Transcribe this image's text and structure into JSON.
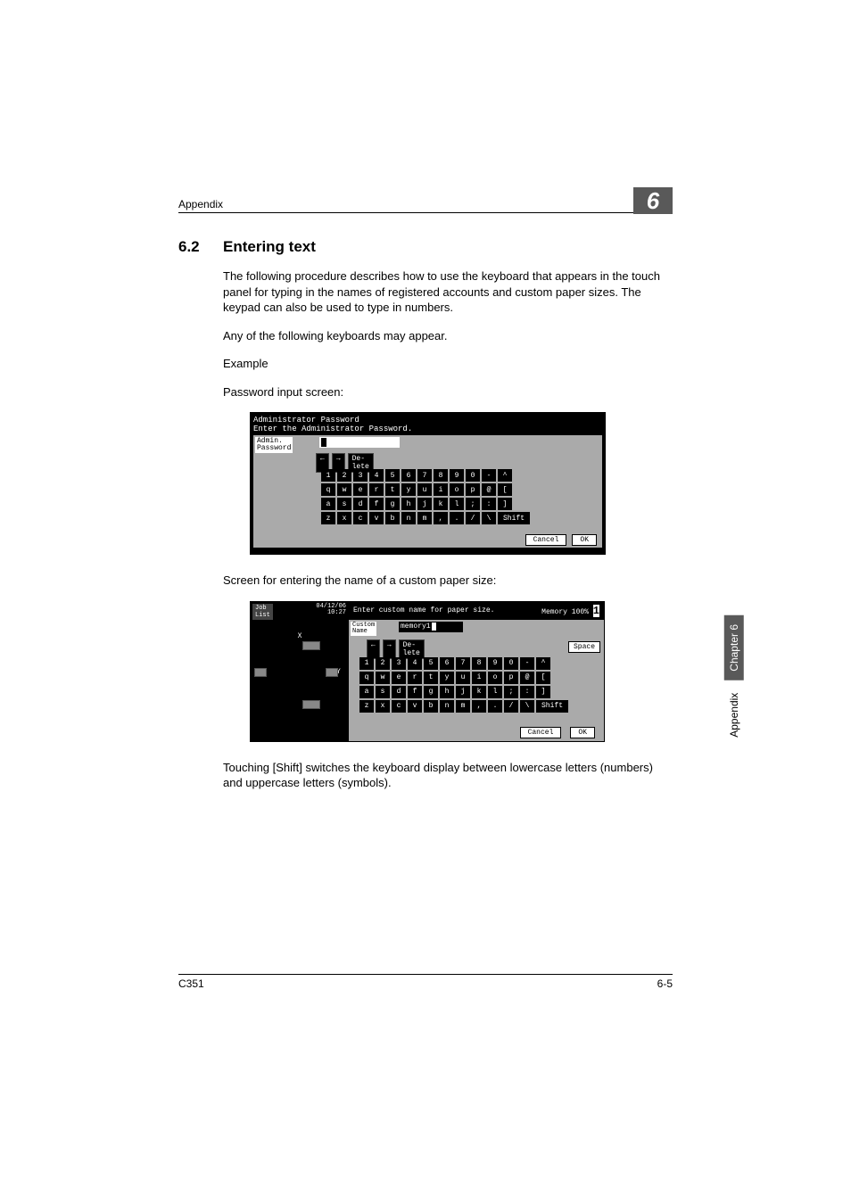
{
  "header": {
    "appendix": "Appendix",
    "chapter_number": "6"
  },
  "section": {
    "number": "6.2",
    "title": "Entering text"
  },
  "paragraphs": {
    "intro": "The following procedure describes how to use the keyboard that appears in the touch panel for typing in the names of registered accounts and custom paper sizes. The keypad can also be used to type in numbers.",
    "any_kb": "Any of the following keyboards may appear.",
    "example": "Example",
    "pwd_screen": "Password input screen:",
    "custom_screen": "Screen for entering the name of a custom paper size:",
    "shift_note": "Touching [Shift] switches the keyboard display between lowercase letters (numbers) and uppercase letters (symbols)."
  },
  "screenshot1": {
    "title_line1": "Administrator Password",
    "title_line2": "Enter the Administrator Password.",
    "label_l1": "Admin.",
    "label_l2": "Password",
    "nav_left": "←",
    "nav_right": "→",
    "nav_delete": "De-\nlete",
    "rows": {
      "r1": [
        "1",
        "2",
        "3",
        "4",
        "5",
        "6",
        "7",
        "8",
        "9",
        "0",
        "-",
        "^"
      ],
      "r2": [
        "q",
        "w",
        "e",
        "r",
        "t",
        "y",
        "u",
        "i",
        "o",
        "p",
        "@",
        "["
      ],
      "r3": [
        "a",
        "s",
        "d",
        "f",
        "g",
        "h",
        "j",
        "k",
        "l",
        ";",
        ":",
        "]"
      ],
      "r4": [
        "z",
        "x",
        "c",
        "v",
        "b",
        "n",
        "m",
        ",",
        ".",
        "/",
        "\\"
      ]
    },
    "shift": "Shift",
    "cancel": "Cancel",
    "ok": "OK"
  },
  "screenshot2": {
    "job_list": "Job\nList",
    "date": "04/12/06",
    "time": "10:27",
    "head_text": "Enter custom name for paper size.",
    "memory_label": "Memory",
    "memory_pct": "100%",
    "one": "1",
    "custom_l1": "Custom",
    "custom_l2": "Name",
    "memory_value": "memory1",
    "axis_x": "X",
    "axis_y": "Y",
    "nav_left": "←",
    "nav_right": "→",
    "nav_delete": "De-\nlete",
    "space": "Space",
    "rows": {
      "r1": [
        "1",
        "2",
        "3",
        "4",
        "5",
        "6",
        "7",
        "8",
        "9",
        "0",
        "-",
        "^"
      ],
      "r2": [
        "q",
        "w",
        "e",
        "r",
        "t",
        "y",
        "u",
        "i",
        "o",
        "p",
        "@",
        "["
      ],
      "r3": [
        "a",
        "s",
        "d",
        "f",
        "g",
        "h",
        "j",
        "k",
        "l",
        ";",
        ":",
        "]"
      ],
      "r4": [
        "z",
        "x",
        "c",
        "v",
        "b",
        "n",
        "m",
        ",",
        ".",
        "/",
        "\\"
      ]
    },
    "shift": "Shift",
    "cancel": "Cancel",
    "ok": "OK"
  },
  "side_tab": {
    "appendix": "Appendix",
    "chapter": "Chapter 6"
  },
  "footer": {
    "model": "C351",
    "page": "6-5"
  }
}
